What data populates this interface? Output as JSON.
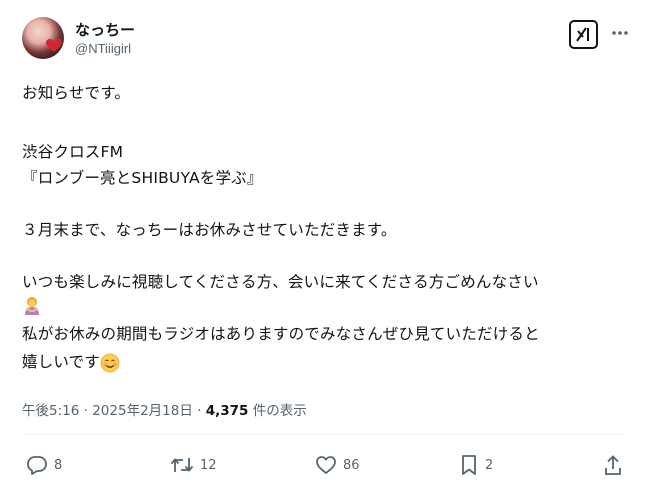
{
  "author": {
    "display_name": "なっちー",
    "handle": "@NTiiigirl"
  },
  "icons": {
    "avatar": "profile-photo",
    "grok": "grok-icon",
    "more": "more-dots-icon",
    "reply": "reply-icon",
    "repost": "repost-icon",
    "like": "like-icon",
    "bookmark": "bookmark-icon",
    "share": "share-icon"
  },
  "post": {
    "lines": [
      "お知らせです。",
      "渋谷クロスFM",
      "『ロンブー亮とSHIBUYAを学ぶ』",
      "３月末まで、なっちーはお休みさせていただきます。",
      "いつも楽しみに視聴してくださる方、会いに来てくださる方ごめんなさい",
      "私がお休みの期間もラジオはありますのでみなさんぜひ見ていただけると",
      "嬉しいです"
    ]
  },
  "meta": {
    "time": "午後5:16",
    "sep1": "·",
    "date": "2025年2月18日",
    "sep2": "·",
    "views": "4,375",
    "views_label": "件の表示"
  },
  "actions": {
    "replies": "8",
    "reposts": "12",
    "likes": "86",
    "bookmarks": "2"
  },
  "colors": {
    "text": "#0f1419",
    "secondary": "#536471",
    "divider": "#eff3f4"
  }
}
